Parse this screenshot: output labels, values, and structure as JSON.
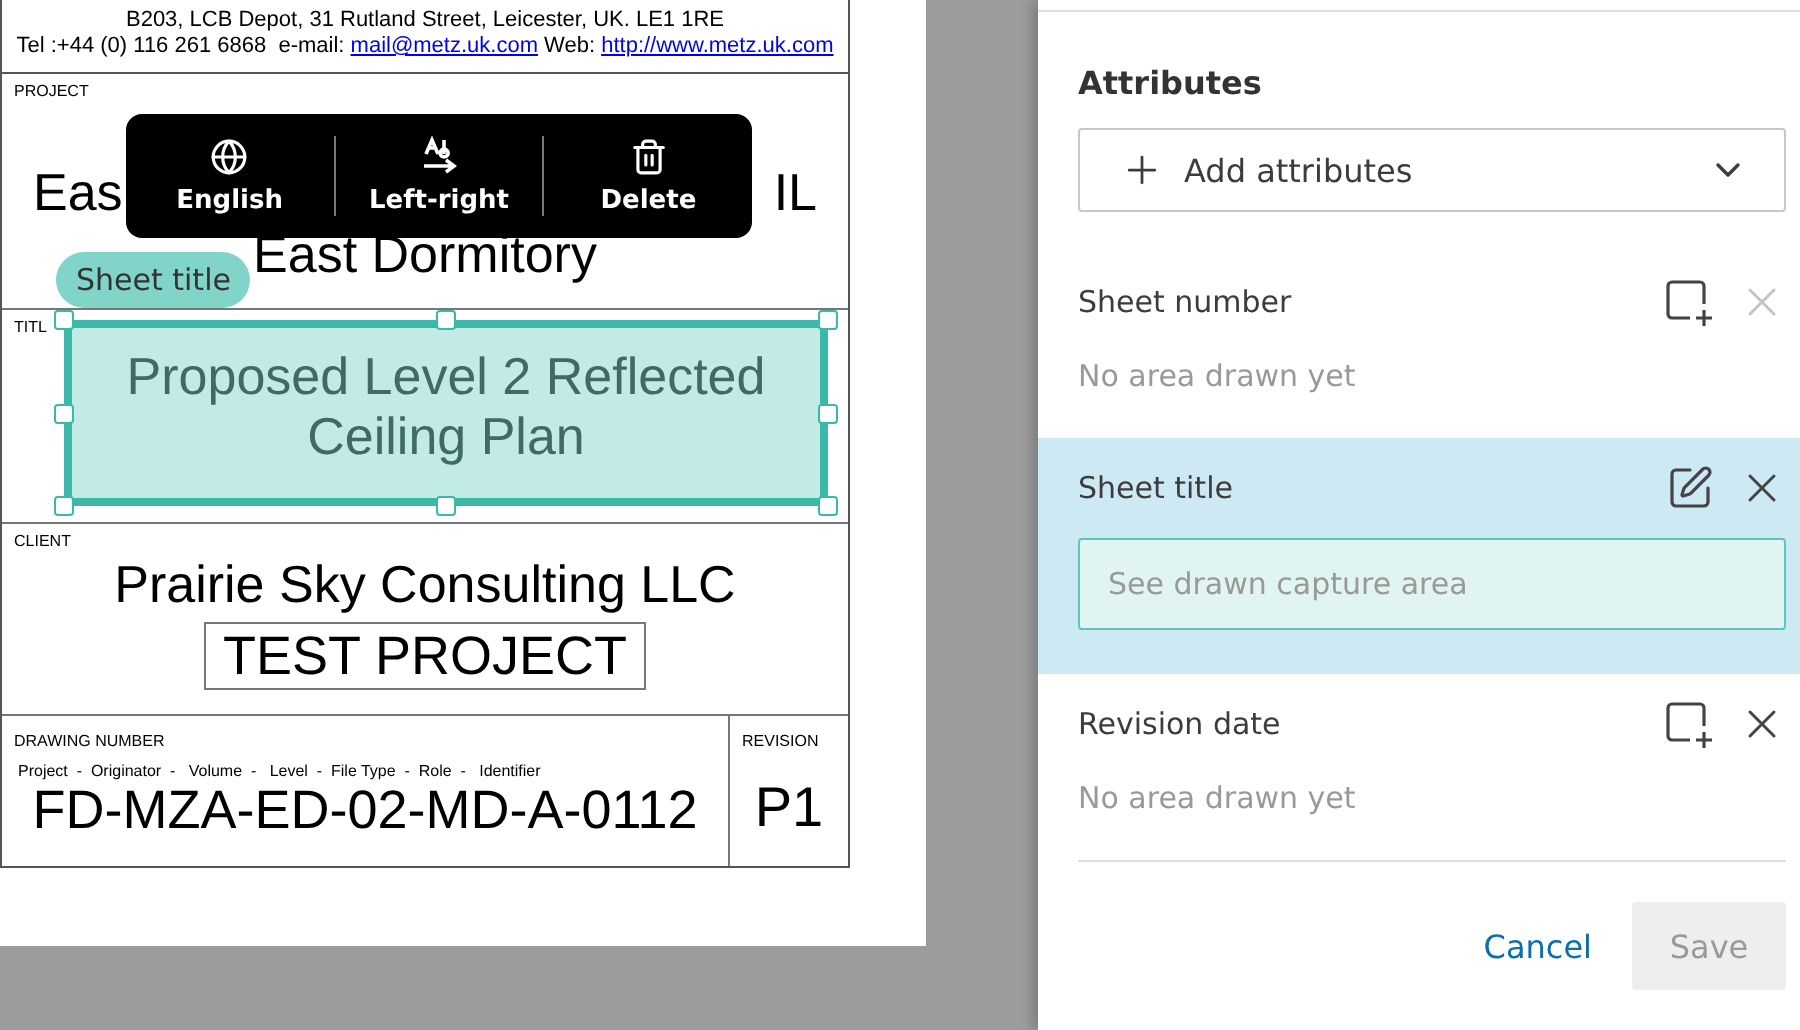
{
  "title_block": {
    "address_line": "B203, LCB Depot, 31 Rutland Street, Leicester, UK. LE1 1RE",
    "contact": {
      "tel": "Tel :+44 (0) 116 261 6868  e-mail:",
      "email": "mail@metz.uk.com",
      "web_label": "Web:",
      "web": "http://www.metz.uk.com"
    },
    "project": {
      "label": "PROJECT",
      "name_line_1_visible": [
        "Eas",
        "IL"
      ],
      "name_line_2": "East Dormitory"
    },
    "title": {
      "label": "TITL",
      "text": "Proposed Level 2 Reflected Ceiling Plan"
    },
    "client": {
      "label": "CLIENT",
      "name": "Prairie Sky Consulting LLC",
      "project": "TEST PROJECT"
    },
    "drawing_number": {
      "label": "DRAWING NUMBER",
      "legend": "Project  -  Originator  -   Volume  -   Level  -  File Type  -  Role  -   Identifier",
      "value": "FD-MZA-ED-02-MD-A-0112"
    },
    "revision": {
      "label": "REVISION",
      "value": "P1"
    }
  },
  "capture_area": {
    "tag": "Sheet title",
    "selected": true
  },
  "toolbar": [
    {
      "label": "English"
    },
    {
      "label": "Left-right"
    },
    {
      "label": "Delete"
    }
  ],
  "panel": {
    "heading": "Attributes",
    "add_dropdown": {
      "label": "Add attributes"
    },
    "attributes": [
      {
        "name": "Sheet number",
        "area_drawn": false,
        "selected": false,
        "remove_enabled": false,
        "status": "No area drawn yet"
      },
      {
        "name": "Sheet title",
        "area_drawn": true,
        "selected": true,
        "remove_enabled": true,
        "placeholder": "See drawn capture area"
      },
      {
        "name": "Revision date",
        "area_drawn": false,
        "selected": false,
        "remove_enabled": true,
        "status": "No area drawn yet"
      }
    ],
    "cancel": {
      "label": "Cancel"
    },
    "save": {
      "label": "Save",
      "disabled": true
    }
  }
}
